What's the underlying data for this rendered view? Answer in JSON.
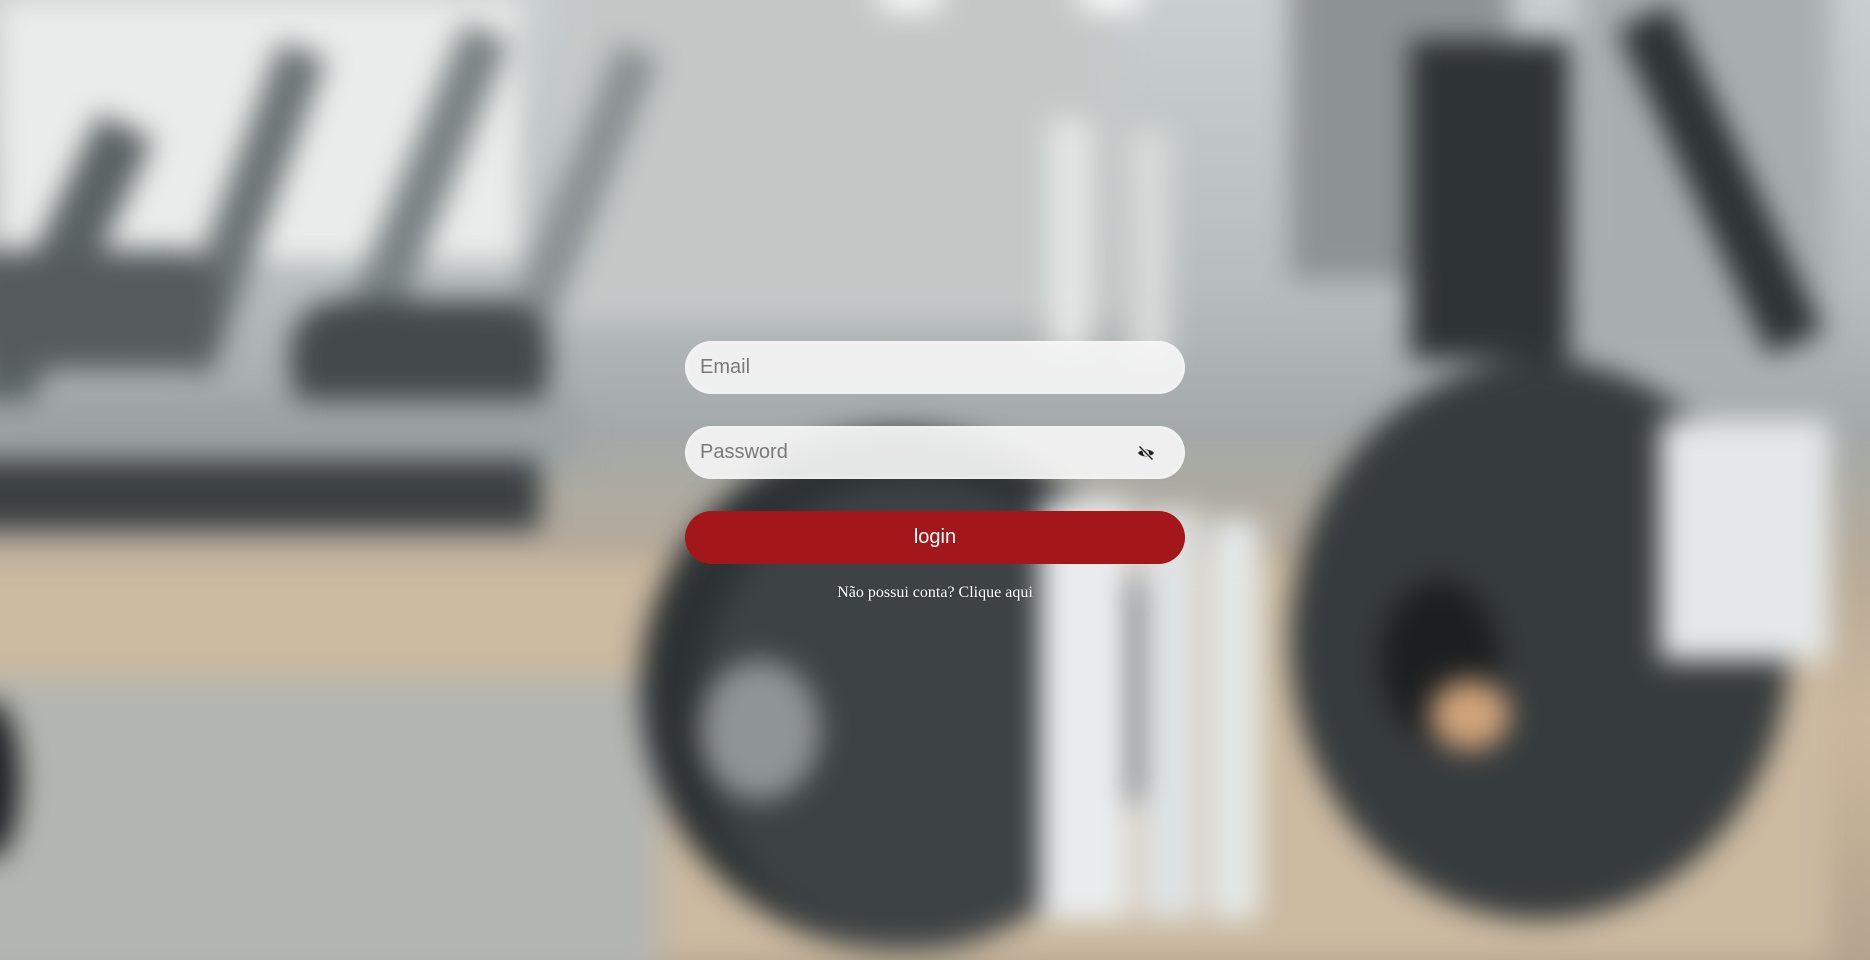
{
  "login": {
    "email_placeholder": "Email",
    "password_placeholder": "Password",
    "button_label": "login",
    "no_account_text": "Não possui conta?",
    "signup_link_label": "Clique aqui"
  },
  "icons": {
    "password_toggle": "eye-slash-icon"
  },
  "colors": {
    "button": "#a31619",
    "input_background": "#f5f5f5",
    "signup_text": "#ffffff"
  }
}
